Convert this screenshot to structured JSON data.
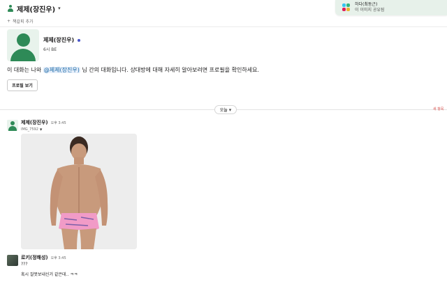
{
  "header": {
    "title": "제제(장진우)",
    "bookmark_label": "책갈피 추가"
  },
  "toast": {
    "line1": "하다(최동근)",
    "line2": "이 이미지 공유됨"
  },
  "profile": {
    "name": "제제(장진우)",
    "local_time": "6시 BE",
    "intro_before": "이 대화는 나와 ",
    "intro_mention": "@제제(장진우)",
    "intro_after": " 님 간의 대화입니다. 상대방에 대해 자세히 알아보려면 프로필을 확인하세요.",
    "view_profile_button": "프로필 보기"
  },
  "divider": {
    "date_label": "오늘",
    "new_label": "새 항목"
  },
  "messages": [
    {
      "author": "제제(장진우)",
      "time": "오후 3:45",
      "file_label": "IMG_7592",
      "image_alt": "photo"
    },
    {
      "author": "로키(정해성)",
      "time": "오후 3:45",
      "lines": [
        "???",
        "혹시 잘못보내신거 같은데.. ㅋㅋ"
      ]
    }
  ],
  "colors": {
    "accent_green": "#2e8a57",
    "mention_bg": "#e8f0fb",
    "mention_text": "#1264a3",
    "new_red": "#d9534f",
    "toast_bg": "#e7f1ea"
  }
}
